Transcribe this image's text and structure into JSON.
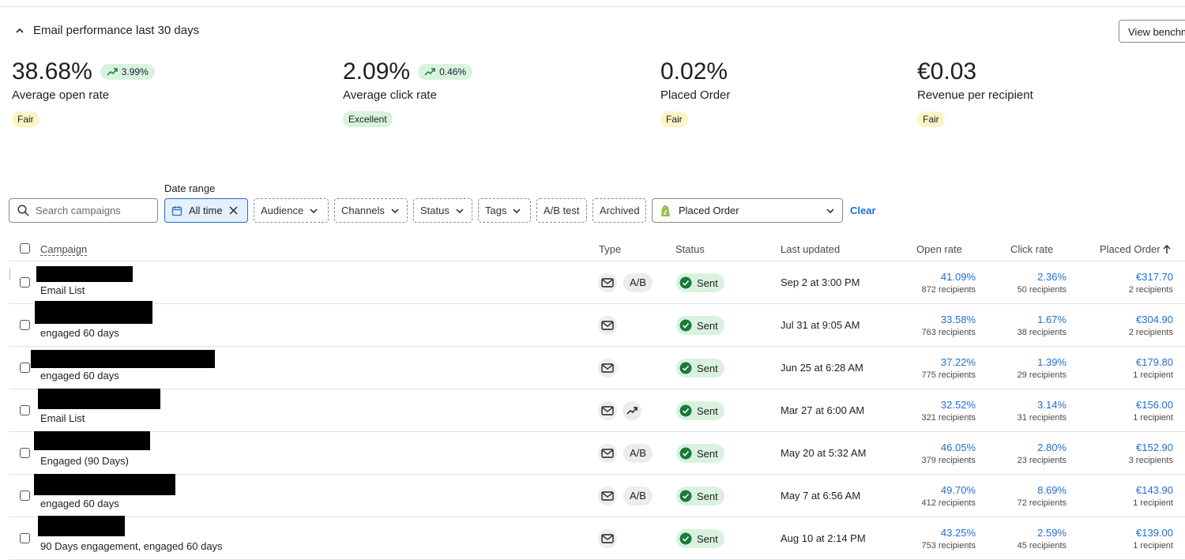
{
  "performance": {
    "title": "Email performance last 30 days",
    "benchmarks_button": "View benchmarks",
    "metrics": [
      {
        "value": "38.68%",
        "trend": "3.99%",
        "name": "Average open rate",
        "badge": "Fair"
      },
      {
        "value": "2.09%",
        "trend": "0.46%",
        "name": "Average click rate",
        "badge": "Excellent"
      },
      {
        "value": "0.02%",
        "name": "Placed Order",
        "badge": "Fair"
      },
      {
        "value": "€0.03",
        "name": "Revenue per recipient",
        "badge": "Fair"
      }
    ]
  },
  "filters": {
    "search_placeholder": "Search campaigns",
    "date_range_label": "Date range",
    "date_range_value": "All time",
    "chips": [
      "Audience",
      "Channels",
      "Status",
      "Tags",
      "A/B test",
      "Archived"
    ],
    "metric_select": "Placed Order",
    "clear": "Clear"
  },
  "table": {
    "headers": {
      "campaign": "Campaign",
      "type": "Type",
      "status": "Status",
      "updated": "Last updated",
      "open": "Open rate",
      "click": "Click rate",
      "placed": "Placed Order"
    },
    "rows": [
      {
        "list": "Email List",
        "ab": "A/B",
        "status": "Sent",
        "updated": "Sep 2 at 3:00 PM",
        "open": "41.09%",
        "open_recipients": "872 recipients",
        "click": "2.36%",
        "click_recipients": "50 recipients",
        "placed": "€317.70",
        "placed_recipients": "2 recipients"
      },
      {
        "list": "engaged 60 days",
        "status": "Sent",
        "updated": "Jul 31 at 9:05 AM",
        "open": "33.58%",
        "open_recipients": "763 recipients",
        "click": "1.67%",
        "click_recipients": "38 recipients",
        "placed": "€304.90",
        "placed_recipients": "2 recipients"
      },
      {
        "list": "engaged 60 days",
        "status": "Sent",
        "updated": "Jun 25 at 6:28 AM",
        "open": "37.22%",
        "open_recipients": "775 recipients",
        "click": "1.39%",
        "click_recipients": "29 recipients",
        "placed": "€179.80",
        "placed_recipients": "1 recipient"
      },
      {
        "list": "Email List",
        "status": "Sent",
        "updated": "Mar 27 at 6:00 AM",
        "open": "32.52%",
        "open_recipients": "321 recipients",
        "click": "3.14%",
        "click_recipients": "31 recipients",
        "placed": "€156.00",
        "placed_recipients": "1 recipient"
      },
      {
        "list": "Engaged (90 Days)",
        "ab": "A/B",
        "status": "Sent",
        "updated": "May 20 at 5:32 AM",
        "open": "46.05%",
        "open_recipients": "379 recipients",
        "click": "2.80%",
        "click_recipients": "23 recipients",
        "placed": "€152.90",
        "placed_recipients": "3 recipients"
      },
      {
        "list": "engaged 60 days",
        "ab": "A/B",
        "status": "Sent",
        "updated": "May 7 at 6:56 AM",
        "open": "49.70%",
        "open_recipients": "412 recipients",
        "click": "8.69%",
        "click_recipients": "72 recipients",
        "placed": "€143.90",
        "placed_recipients": "1 recipient"
      },
      {
        "list": "90 Days engagement, engaged 60 days",
        "status": "Sent",
        "updated": "Aug 10 at 2:14 PM",
        "open": "43.25%",
        "open_recipients": "753 recipients",
        "click": "2.59%",
        "click_recipients": "45 recipients",
        "placed": "€139.00",
        "placed_recipients": "1 recipient"
      }
    ]
  }
}
